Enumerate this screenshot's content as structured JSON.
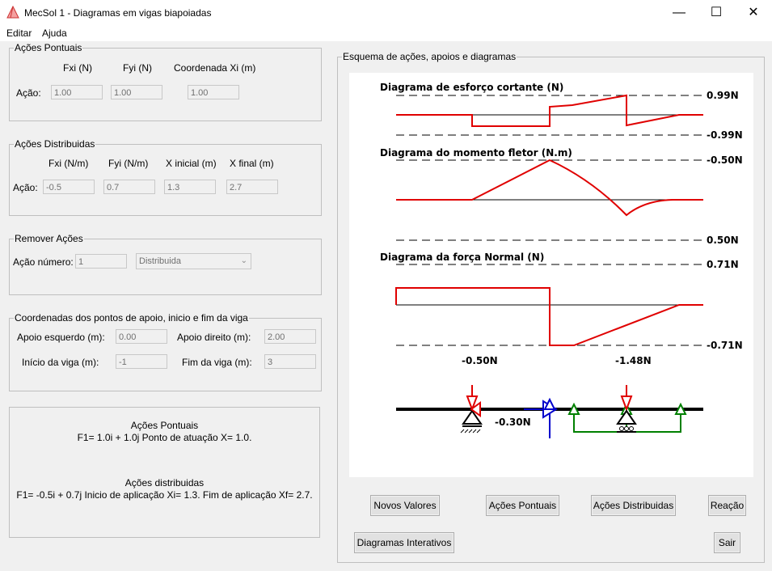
{
  "window": {
    "title": "MecSol 1 - Diagramas em vigas biapoiadas",
    "minimize": "—",
    "maximize": "☐",
    "close": "✕"
  },
  "menu": {
    "edit": "Editar",
    "help": "Ajuda"
  },
  "point_actions": {
    "legend": "Ações Pontuais",
    "col_fx": "Fxi (N)",
    "col_fy": "Fyi (N)",
    "col_x": "Coordenada Xi (m)",
    "row_label": "Ação:",
    "fx": "1.00",
    "fy": "1.00",
    "x": "1.00"
  },
  "dist_actions": {
    "legend": "Ações Distribuidas",
    "col_fx": "Fxi (N/m)",
    "col_fy": "Fyi (N/m)",
    "col_xi": "X inicial (m)",
    "col_xf": "X final (m)",
    "row_label": "Ação:",
    "fx": "-0.5",
    "fy": "0.7",
    "xi": "1.3",
    "xf": "2.7"
  },
  "remove": {
    "legend": "Remover Ações",
    "label": "Ação número:",
    "number": "1",
    "type_selected": "Distribuida"
  },
  "coords": {
    "legend": "Coordenadas dos pontos de apoio, inicio e fim da viga",
    "left_label": "Apoio esquerdo (m):",
    "left": "0.00",
    "right_label": "Apoio direito (m):",
    "right": "2.00",
    "start_label": "Início da viga (m):",
    "start": "-1",
    "end_label": "Fim da viga (m):",
    "end": "3"
  },
  "summary": {
    "point_title": "Ações Pontuais",
    "point_line": "F1= 1.0i + 1.0j Ponto de atuação X= 1.0.",
    "dist_title": "Ações distribuidas",
    "dist_line": "F1= -0.5i + 0.7j Inicio de aplicação Xi= 1.3. Fim de aplicação Xf= 2.7."
  },
  "diagram": {
    "legend": "Esquema de ações, apoios e diagramas",
    "shear_title": "Diagrama de esforço cortante (N)",
    "shear_max": "0.99N",
    "shear_min": "-0.99N",
    "moment_title": "Diagrama do momento fletor (N.m)",
    "moment_top": "-0.50N",
    "moment_bottom": "0.50N",
    "normal_title": "Diagrama da força Normal (N)",
    "normal_max": "0.71N",
    "normal_min": "-0.71N",
    "reaction_left": "-0.50N",
    "reaction_right": "-1.48N",
    "reaction_horizontal": "-0.30N",
    "line_color": "#e00000",
    "support_color": "#000000",
    "horizontal_reaction_color": "#0000cc",
    "distributed_color": "#008000"
  },
  "buttons": {
    "new_values": "Novos Valores",
    "point_actions": "Ações Pontuais",
    "dist_actions": "Ações Distribuidas",
    "reaction": "Reação",
    "interactive": "Diagramas Interativos",
    "exit": "Sair"
  }
}
